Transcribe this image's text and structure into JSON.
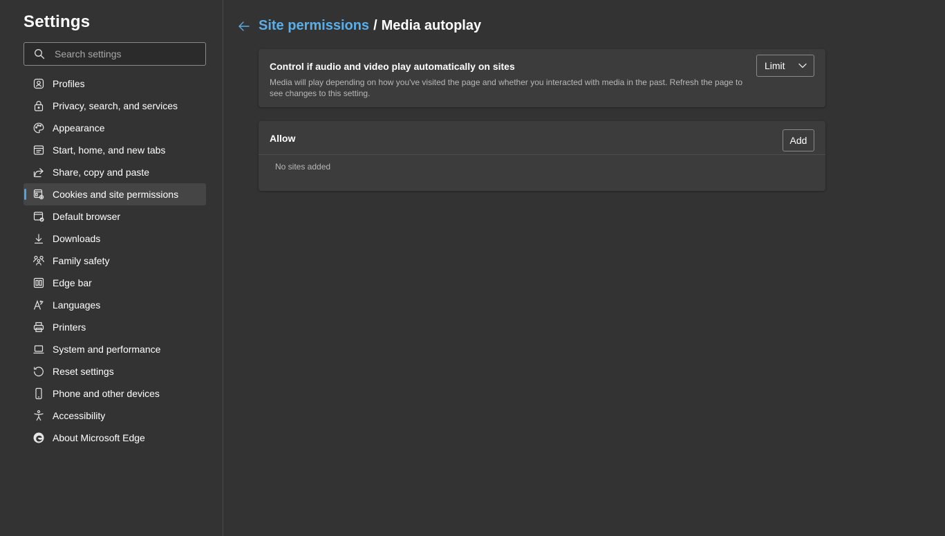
{
  "sidebar": {
    "title": "Settings",
    "search": {
      "placeholder": "Search settings",
      "value": ""
    },
    "items": [
      {
        "label": "Profiles",
        "icon": "profile-icon",
        "active": false
      },
      {
        "label": "Privacy, search, and services",
        "icon": "lock-icon",
        "active": false
      },
      {
        "label": "Appearance",
        "icon": "palette-icon",
        "active": false
      },
      {
        "label": "Start, home, and new tabs",
        "icon": "home-tabs-icon",
        "active": false
      },
      {
        "label": "Share, copy and paste",
        "icon": "share-icon",
        "active": false
      },
      {
        "label": "Cookies and site permissions",
        "icon": "cookies-permissions-icon",
        "active": true
      },
      {
        "label": "Default browser",
        "icon": "default-browser-icon",
        "active": false
      },
      {
        "label": "Downloads",
        "icon": "download-icon",
        "active": false
      },
      {
        "label": "Family safety",
        "icon": "family-icon",
        "active": false
      },
      {
        "label": "Edge bar",
        "icon": "edge-bar-icon",
        "active": false
      },
      {
        "label": "Languages",
        "icon": "languages-icon",
        "active": false
      },
      {
        "label": "Printers",
        "icon": "printer-icon",
        "active": false
      },
      {
        "label": "System and performance",
        "icon": "laptop-icon",
        "active": false
      },
      {
        "label": "Reset settings",
        "icon": "reset-icon",
        "active": false
      },
      {
        "label": "Phone and other devices",
        "icon": "phone-icon",
        "active": false
      },
      {
        "label": "Accessibility",
        "icon": "accessibility-icon",
        "active": false
      },
      {
        "label": "About Microsoft Edge",
        "icon": "edge-logo-icon",
        "active": false
      }
    ]
  },
  "header": {
    "parent": "Site permissions",
    "separator": "/",
    "current": "Media autoplay"
  },
  "autoplay": {
    "title": "Control if audio and video play automatically on sites",
    "description": "Media will play depending on how you've visited the page and whether you interacted with media in the past. Refresh the page to see changes to this setting.",
    "selected": "Limit"
  },
  "allow": {
    "title": "Allow",
    "add_label": "Add",
    "empty_text": "No sites added"
  },
  "colors": {
    "background": "#333333",
    "card": "#3c3c3c",
    "accent": "#5aaeea",
    "active_item": "#454545"
  }
}
